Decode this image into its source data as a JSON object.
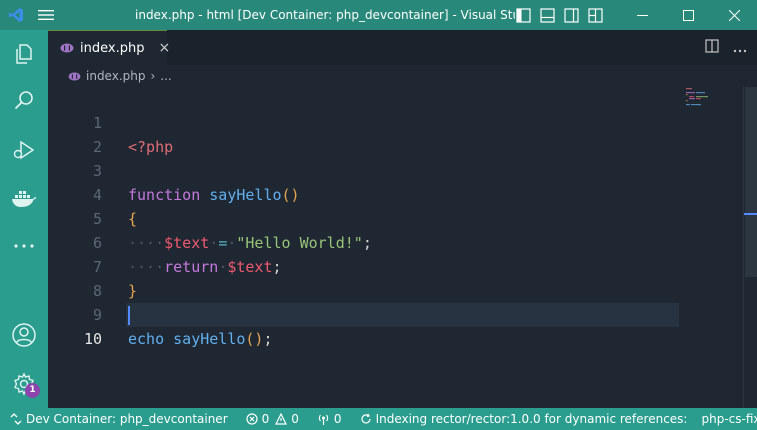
{
  "titlebar": {
    "title": "index.php - html [Dev Container: php_devcontainer] - Visual Studio C",
    "icons": [
      "vscode-logo-icon",
      "menu-icon",
      "toggle-primary-sidebar-icon",
      "toggle-panel-icon",
      "toggle-secondary-sidebar-icon",
      "customize-layout-icon",
      "minimize-icon",
      "maximize-icon",
      "close-icon"
    ]
  },
  "activity_bar": {
    "items": [
      "explorer-icon",
      "search-icon",
      "run-debug-icon",
      "docker-icon",
      "more-icon"
    ],
    "bottom": [
      "accounts-icon",
      "manage-gear-icon"
    ],
    "manage_badge": "1"
  },
  "tabs": [
    {
      "label": "index.php",
      "icon": "php-file-icon",
      "close": "×"
    }
  ],
  "breadcrumb": {
    "file": "index.php",
    "separator": "›",
    "rest": "..."
  },
  "editor": {
    "line_numbers": [
      "1",
      "2",
      "3",
      "4",
      "5",
      "6",
      "7",
      "8",
      "9",
      "10"
    ],
    "active_line": 10,
    "code": {
      "l1": {
        "tag": "<?php"
      },
      "l3": {
        "kw": "function",
        "fn": "sayHello",
        "parens": "()"
      },
      "l4": {
        "brace": "{"
      },
      "l5": {
        "indent": "····",
        "var": "$text",
        "eq": "=",
        "str": "\"Hello World!\"",
        "semi": ";"
      },
      "l6": {
        "indent": "····",
        "kw": "return",
        "var": "$text",
        "semi": ";"
      },
      "l7": {
        "brace": "}"
      },
      "l9": {
        "kw": "echo",
        "fn": "sayHello",
        "parens": "()",
        "semi": ";"
      }
    }
  },
  "statusbar": {
    "remote": "Dev Container: php_devcontainer",
    "errors": "0",
    "warnings": "0",
    "ports": "0",
    "indexing": "Indexing rector/rector:1.0.0 for dynamic references:",
    "fixer": "php-cs-fixer: Paths from"
  },
  "colors": {
    "accent": "#2a9d8f",
    "editor_bg": "#1e2732",
    "badge": "#8e44ad"
  }
}
